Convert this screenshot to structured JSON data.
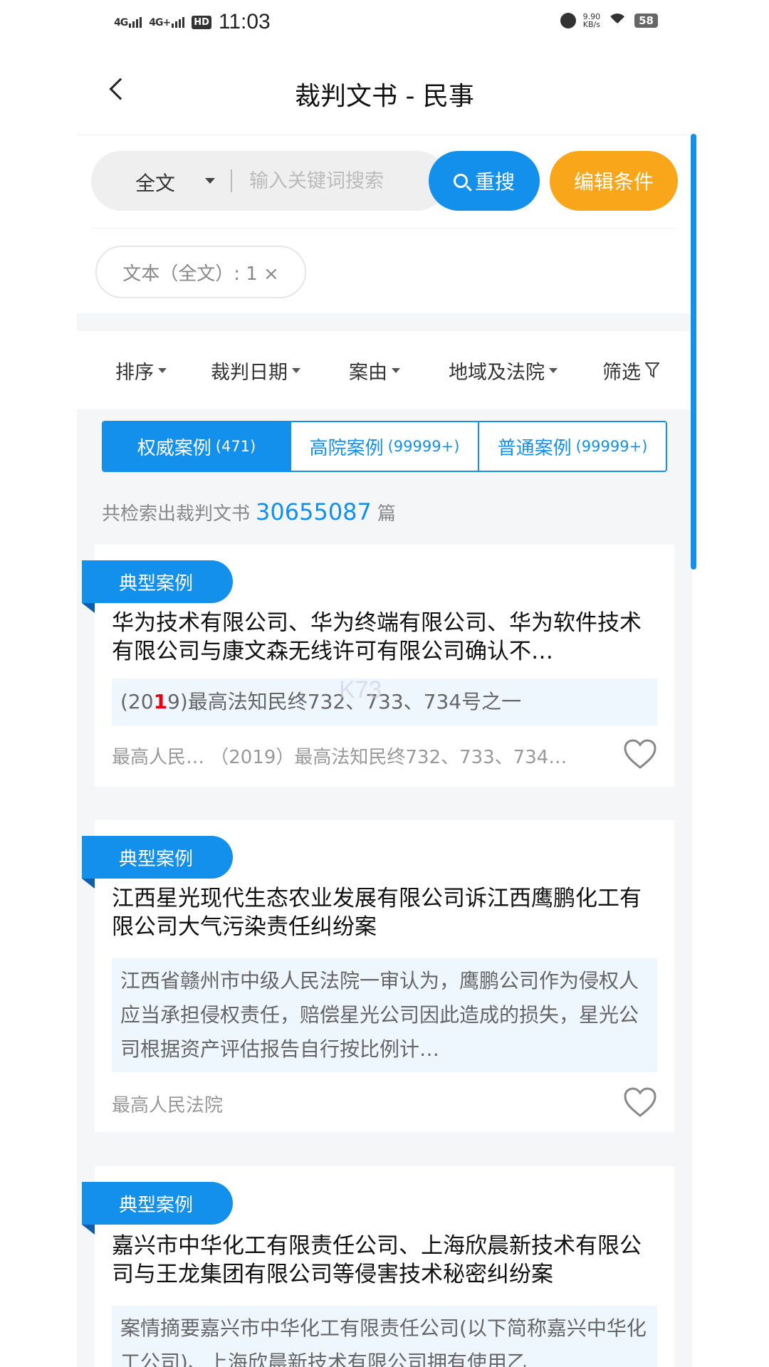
{
  "status": {
    "signal1": "4G",
    "signal2": "4G+",
    "hd": "HD",
    "time": "11:03",
    "net_speed": "9.90",
    "net_unit": "KB/s",
    "battery": "58"
  },
  "nav": {
    "title": "裁判文书 - 民事"
  },
  "search": {
    "scope": "全文",
    "placeholder": "输入关键词搜索",
    "value": "",
    "search_button": "重搜",
    "edit_button": "编辑条件",
    "chip": "文本（全文）: 1 ×"
  },
  "filters": [
    "排序",
    "裁判日期",
    "案由",
    "地域及法院",
    "筛选"
  ],
  "tabs": [
    {
      "label": "权威案例",
      "count": "(471)",
      "active": true
    },
    {
      "label": "高院案例",
      "count": "(99999+)",
      "active": false
    },
    {
      "label": "普通案例",
      "count": "(99999+)",
      "active": false
    }
  ],
  "total": {
    "prefix": "共检索出裁判文书",
    "number": "30655087",
    "suffix": "篇"
  },
  "cases": [
    {
      "tag": "典型案例",
      "title": "华为技术有限公司、华为终端有限公司、华为软件技术有限公司与康文森无线许可有限公司确认不…",
      "snippet_pre": "(20",
      "snippet_hl": "1",
      "snippet_post": "9)最高法知民终732、733、734号之一",
      "meta": "最高人民…  （2019）最高法知民终732、733、734…"
    },
    {
      "tag": "典型案例",
      "title": "江西星光现代生态农业发展有限公司诉江西鹰鹏化工有限公司大气污染责任纠纷案",
      "snippet": "江西省赣州市中级人民法院一审认为，鹰鹏公司作为侵权人应当承担侵权责任，赔偿星光公司因此造成的损失，星光公司根据资产评估报告自行按比例计…",
      "meta": "最高人民法院"
    },
    {
      "tag": "典型案例",
      "title": "嘉兴市中华化工有限责任公司、上海欣晨新技术有限公司与王龙集团有限公司等侵害技术秘密纠纷案",
      "snippet": "案情摘要嘉兴市中华化工有限责任公司(以下简称嘉兴中华化工公司)、上海欣晨新技术有限公司拥有使用乙"
    }
  ],
  "watermark": "K73"
}
